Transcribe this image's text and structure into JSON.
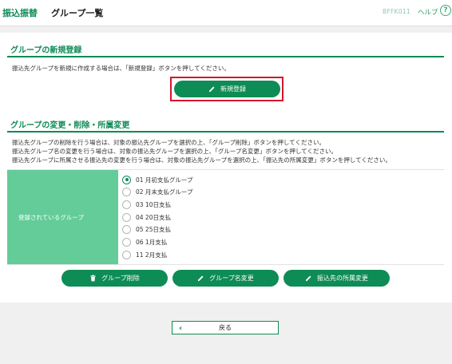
{
  "header": {
    "category": "振込振替",
    "title": "グループ一覧",
    "screen_id": "BFFK011",
    "help_label": "ヘルプ",
    "help_icon": "?"
  },
  "new_section": {
    "title": "グループの新規登録",
    "description": "振込先グループを新規に作成する場合は、「新規登録」ボタンを押してください。",
    "new_button_label": "新規登録"
  },
  "edit_section": {
    "title": "グループの変更・削除・所属変更",
    "descriptions": [
      "振込先グループの削除を行う場合は、対象の振込先グループを選択の上、「グループ削除」ボタンを押してください。",
      "振込先グループ名の変更を行う場合は、対象の振込先グループを選択の上、「グループ名変更」ボタンを押してください。",
      "振込先グループに所属させる振込先の変更を行う場合は、対象の振込先グループを選択の上、「振込先の所属変更」ボタンを押してください。"
    ],
    "table_label": "登録されているグループ",
    "groups": [
      {
        "label": "01 月初支払グループ",
        "selected": true
      },
      {
        "label": "02 月末支払グループ",
        "selected": false
      },
      {
        "label": "03 10日支払",
        "selected": false
      },
      {
        "label": "04 20日支払",
        "selected": false
      },
      {
        "label": "05 25日支払",
        "selected": false
      },
      {
        "label": "06 1月支払",
        "selected": false
      },
      {
        "label": "11 2月支払",
        "selected": false
      }
    ],
    "delete_button_label": "グループ削除",
    "rename_button_label": "グループ名変更",
    "membership_button_label": "振込先の所属変更"
  },
  "footer": {
    "back_button_label": "戻る"
  },
  "colors": {
    "accent_green": "#0e8c55",
    "table_header_green": "#63cc99",
    "highlight_red": "#d6152b"
  }
}
